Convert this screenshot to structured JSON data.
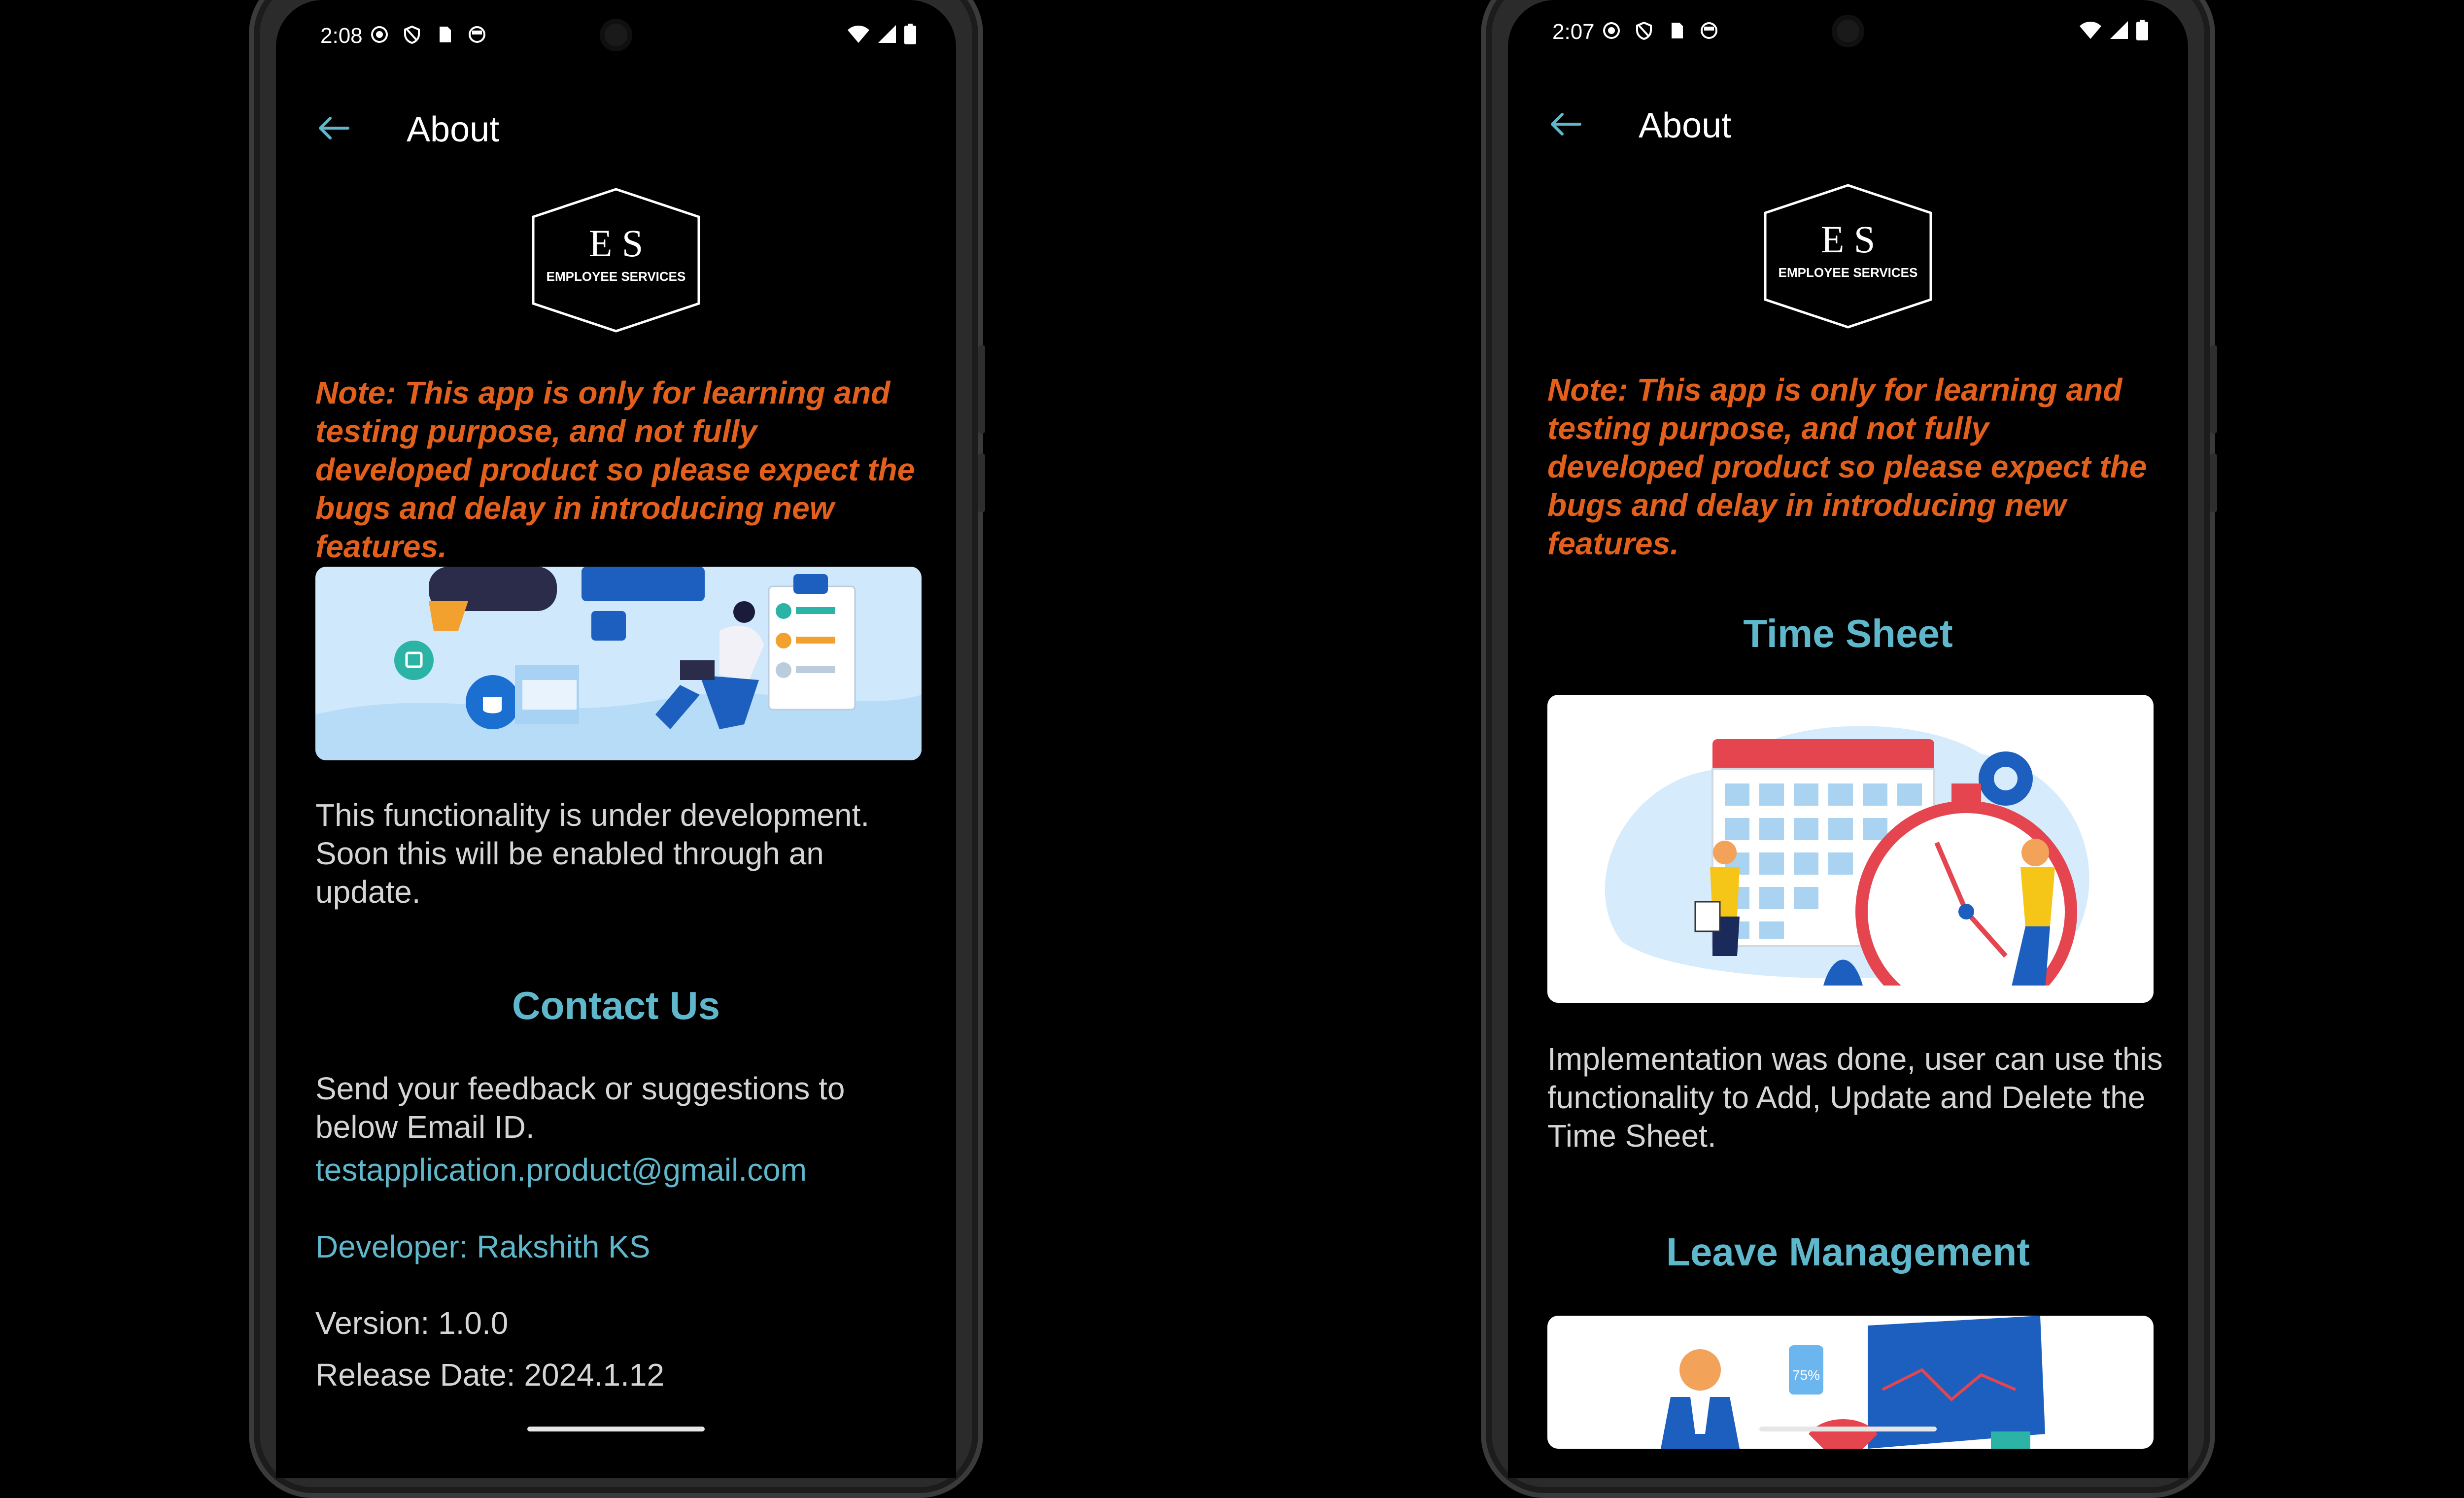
{
  "left": {
    "status": {
      "time": "2:08"
    },
    "appbar": {
      "title": "About"
    },
    "logo": {
      "monogram": "E S",
      "text": "EMPLOYEE SERVICES"
    },
    "note": "Note: This app is only for learning and testing purpose, and not fully developed product so please expect the bugs and delay in introducing new features.",
    "dev_text": "This functionality is under development. Soon this will be enabled through an update.",
    "contact_title": "Contact Us",
    "contact_text": "Send your feedback or suggestions to below Email ID.",
    "email": "testapplication.product@gmail.com",
    "developer": "Developer: Rakshith KS",
    "version": "Version: 1.0.0",
    "release": "Release Date: 2024.1.12"
  },
  "right": {
    "status": {
      "time": "2:07"
    },
    "appbar": {
      "title": "About"
    },
    "logo": {
      "monogram": "E S",
      "text": "EMPLOYEE SERVICES"
    },
    "note": "Note: This app is only for learning and testing purpose, and not fully developed product so please expect the bugs and delay in introducing new features.",
    "timesheet_title": "Time Sheet",
    "timesheet_text": "Implementation was done, user can use this functionality to Add, Update and Delete the Time Sheet.",
    "leave_title": "Leave Management",
    "chart_badge": "75%"
  },
  "colors": {
    "accent": "#5eb7cb",
    "note": "#e2601c",
    "text": "#d5d5d5",
    "background": "#000000"
  },
  "icons": [
    "back-arrow-icon",
    "wifi-icon",
    "signal-icon",
    "battery-icon",
    "shield-icon",
    "sim-card-icon"
  ]
}
